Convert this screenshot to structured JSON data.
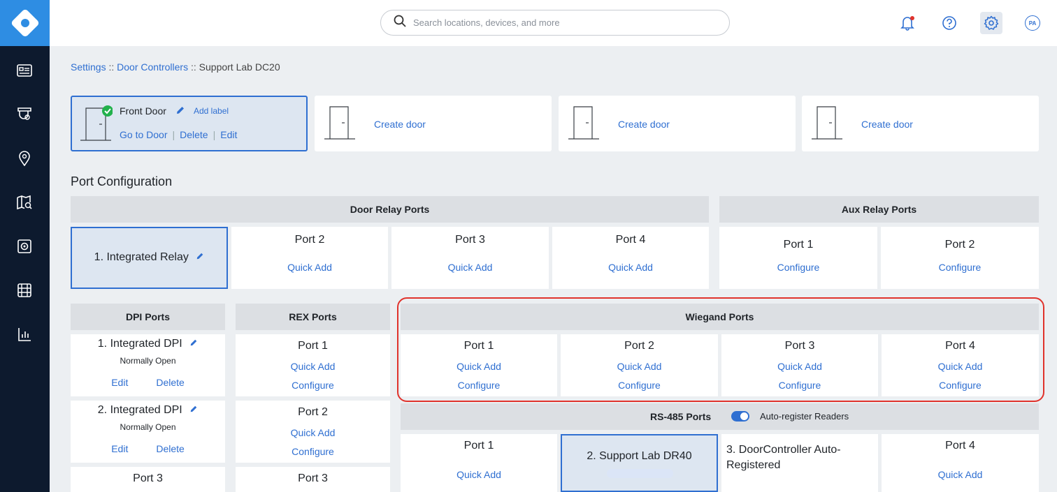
{
  "header": {
    "search_placeholder": "Search locations, devices, and more",
    "avatar_initials": "PA"
  },
  "sidebar": {
    "items": [
      "dashboard-icon",
      "cameras-icon",
      "locations-icon",
      "map-search-icon",
      "devices-icon",
      "video-icon",
      "reports-icon"
    ]
  },
  "breadcrumb": {
    "items": [
      "Settings",
      "Door Controllers"
    ],
    "separator": "::",
    "current": "Support Lab DC20"
  },
  "doors": {
    "front": {
      "name": "Front Door",
      "add_label": "Add label",
      "go_to": "Go to Door",
      "delete": "Delete",
      "edit": "Edit",
      "separator": "|"
    },
    "create_label": "Create door"
  },
  "port_config": {
    "title": "Port Configuration",
    "door_relay": {
      "title": "Door Relay Ports",
      "selected": "1. Integrated Relay",
      "ports": [
        "Port 2",
        "Port 3",
        "Port 4"
      ],
      "action": "Quick Add"
    },
    "aux_relay": {
      "title": "Aux Relay Ports",
      "ports": [
        "Port 1",
        "Port 2"
      ],
      "action": "Configure"
    },
    "dpi": {
      "title": "DPI Ports",
      "items": [
        {
          "name": "1. Integrated DPI",
          "mode": "Normally Open",
          "edit": "Edit",
          "delete": "Delete"
        },
        {
          "name": "2. Integrated DPI",
          "mode": "Normally Open",
          "edit": "Edit",
          "delete": "Delete"
        }
      ],
      "port3": "Port 3"
    },
    "rex": {
      "title": "REX Ports",
      "ports": [
        "Port 1",
        "Port 2",
        "Port 3"
      ],
      "quick_add": "Quick Add",
      "configure": "Configure"
    },
    "wiegand": {
      "title": "Wiegand Ports",
      "ports": [
        "Port 1",
        "Port 2",
        "Port 3",
        "Port 4"
      ],
      "quick_add": "Quick Add",
      "configure": "Configure"
    },
    "rs485": {
      "title": "RS-485 Ports",
      "auto_register_label": "Auto-register Readers",
      "auto_register_on": true,
      "port1": "Port 1",
      "port2_device": "2. Support Lab DR40",
      "port3_device": "3. DoorController Auto-Registered",
      "port4": "Port 4",
      "quick_add": "Quick Add"
    }
  },
  "colors": {
    "accent": "#2f6fd1",
    "sidebar": "#0d1a2e",
    "logo": "#2e8de3",
    "highlight": "#e0332c",
    "success": "#22b14c"
  }
}
